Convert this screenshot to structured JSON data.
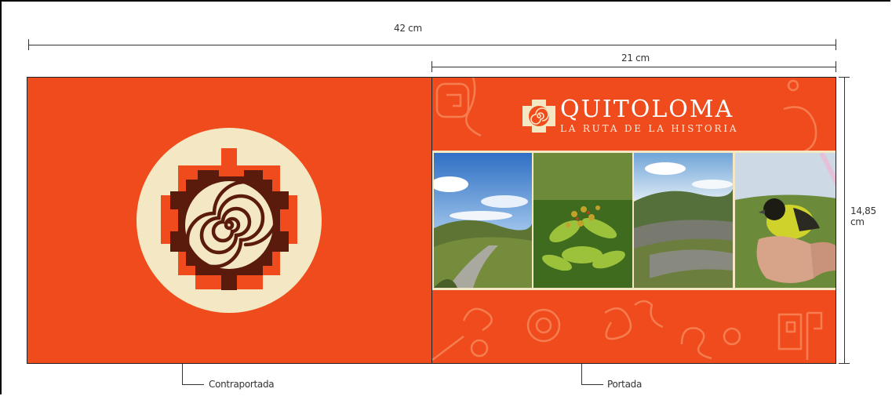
{
  "dimensions": {
    "total_width": "42 cm",
    "cover_width": "21 cm",
    "height": "14,85 cm"
  },
  "labels": {
    "back_cover": "Contraportada",
    "front_cover": "Portada"
  },
  "brand": {
    "name": "QUITOLOMA",
    "tagline": "LA RUTA DE LA HISTORIA"
  },
  "colors": {
    "orange": "#f04b1c",
    "cream": "#f3e7c4",
    "brown": "#5a1a0c"
  },
  "photos": [
    "mountain-road",
    "green-plant",
    "stone-ruins-hillside",
    "yellow-bird-in-hand"
  ]
}
